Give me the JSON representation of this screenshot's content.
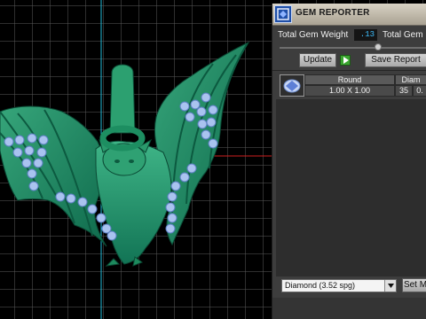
{
  "panel": {
    "title": "GEM REPORTER",
    "total_weight_label": "Total Gem Weight",
    "total_weight_value": ".13",
    "total_gem_label_cut": "Total Gem",
    "update_label": "Update",
    "save_report_label": "Save Report",
    "table": {
      "headers": [
        "Round",
        "Diam"
      ],
      "row": {
        "size": "1.00 X 1.00",
        "count": "35",
        "value_cut": "0."
      }
    },
    "material_select": "Diamond     (3.52 spg)",
    "set_button_cut": "Set M"
  },
  "icons": [
    "app-icon",
    "play-icon",
    "gem-thumbnail-icon",
    "dropdown-arrow-icon"
  ],
  "colors": {
    "model": "#1f8a60",
    "gem": "#a8c4f0",
    "grid": "#5a5a5a",
    "axis_y": "#1fb8d6",
    "axis_x": "#d02020"
  }
}
